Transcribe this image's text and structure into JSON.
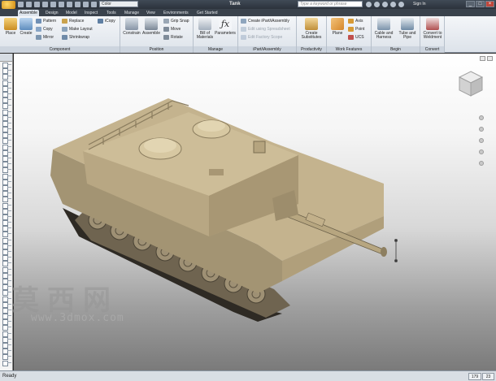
{
  "title_bar": {
    "color_select": "Color",
    "document_title": "Tank",
    "search_placeholder": "Type a keyword or phrase",
    "signin": "Sign In",
    "minimize": "_",
    "restore": "□",
    "close": "×"
  },
  "tabs": [
    "Assemble",
    "Design",
    "Model",
    "Inspect",
    "Tools",
    "Manage",
    "View",
    "Environments",
    "Get Started"
  ],
  "ribbon": {
    "component": {
      "label": "Component",
      "place": "Place",
      "create": "Create",
      "pattern": "Pattern",
      "copy": "Copy",
      "mirror": "Mirror",
      "replace": "Replace",
      "make_layout": "Make Layout",
      "shrinkwrap": "Shrinkwrap",
      "icopy": "iCopy"
    },
    "position": {
      "label": "Position",
      "constrain": "Constrain",
      "assemble": "Assemble",
      "grip_snap": "Grip Snap",
      "move": "Move",
      "rotate": "Rotate"
    },
    "manage": {
      "label": "Manage",
      "bill_of_materials": "Bill of Materials",
      "parameters": "Parameters"
    },
    "ipart": {
      "label": "iPart/iAssembly",
      "create": "Create iPart/iAssembly",
      "edit_factory": "Edit using Spreadsheet",
      "edit_member": "Edit Factory Scope"
    },
    "productivity": {
      "label": "Productivity",
      "create_substitutes": "Create Substitutes"
    },
    "work_features": {
      "label": "Work Features",
      "plane": "Plane",
      "axis": "Axis",
      "point": "Point",
      "ucs": "UCS"
    },
    "begin": {
      "label": "Begin",
      "cable_harness": "Cable and Harness",
      "tube_pipe": "Tube and Pipe"
    },
    "convert": {
      "label": "Convert",
      "convert_weldment": "Convert to Weldment"
    }
  },
  "watermark": {
    "chinese": "莫西网",
    "url": "www.3dmox.com"
  },
  "status_bar": {
    "text": "Ready",
    "count1": "179",
    "count2": "23"
  },
  "colors": {
    "tank_body": "#c2b08a",
    "tank_shadow": "#8d7d5c",
    "ribbon_bg": "#e6ebf1",
    "title_bg": "#333b44"
  }
}
